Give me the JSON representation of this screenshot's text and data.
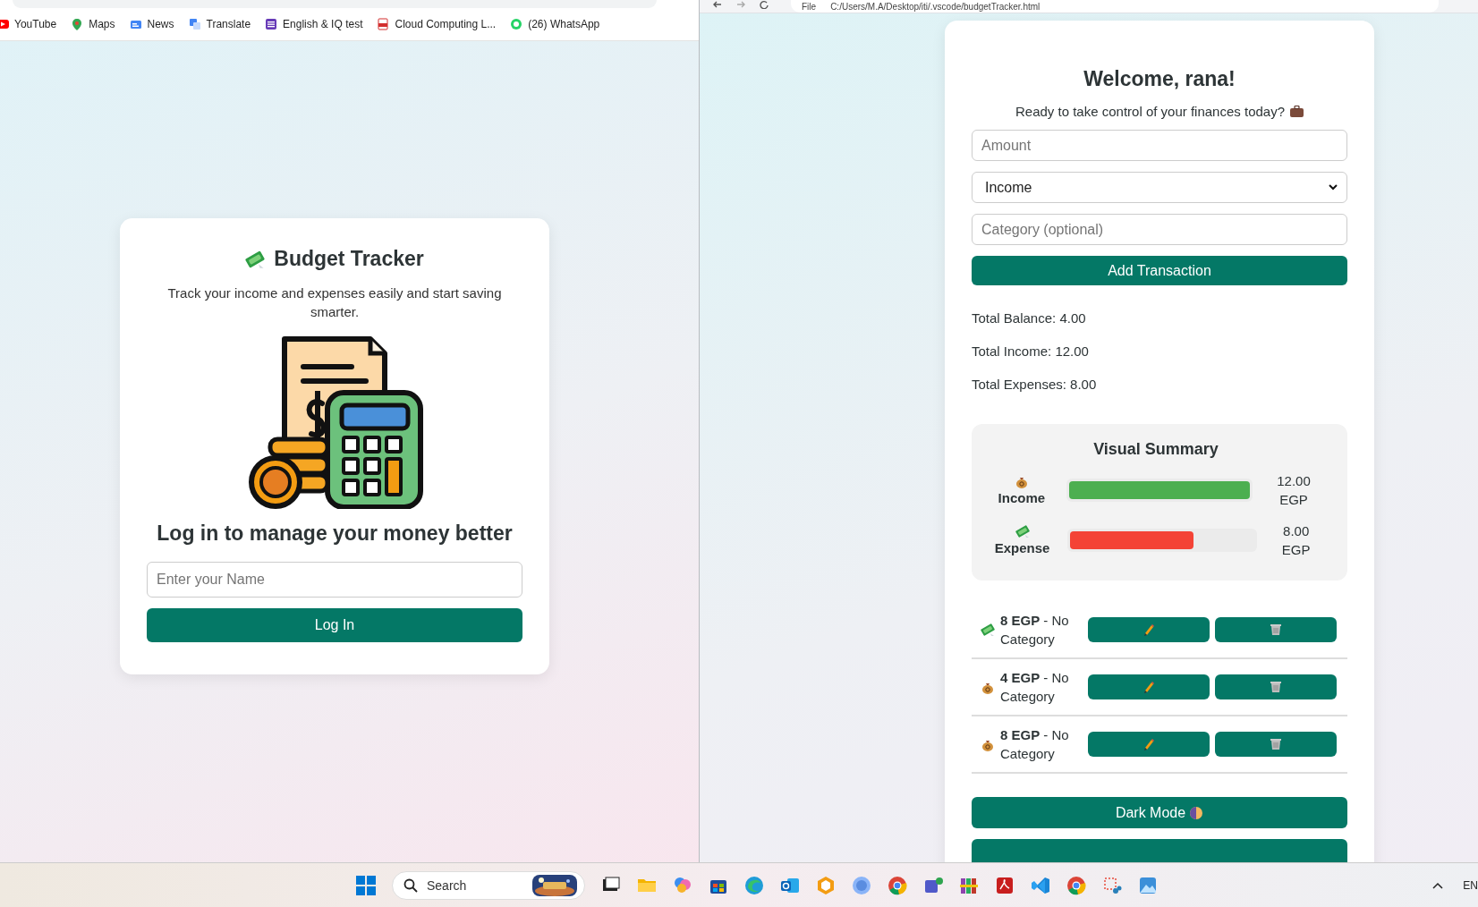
{
  "left_window": {
    "bookmarks": [
      {
        "kind": "youtube",
        "label": "YouTube"
      },
      {
        "kind": "maps",
        "label": "Maps"
      },
      {
        "kind": "news",
        "label": "News"
      },
      {
        "kind": "translate",
        "label": "Translate"
      },
      {
        "kind": "list",
        "label": "English & IQ test"
      },
      {
        "kind": "pdf",
        "label": "Cloud Computing L..."
      },
      {
        "kind": "chat",
        "label": "(26) WhatsApp"
      }
    ],
    "login_card": {
      "title": "Budget Tracker",
      "subtitle": "Track your income and expenses easily and start saving smarter.",
      "heading": "Log in to manage your money better",
      "name_field": {
        "placeholder": "Enter your Name"
      },
      "button": "Log In"
    }
  },
  "right_window": {
    "address": {
      "scheme": "File",
      "url": "C:/Users/M.A/Desktop/iti/.vscode/budgetTracker.html"
    },
    "welcome": "Welcome, rana!",
    "prompt": "Ready to take control of your finances today?",
    "amount_field": {
      "placeholder": "Amount"
    },
    "type_select": {
      "value": "Income"
    },
    "category_field": {
      "placeholder": "Category (optional)"
    },
    "add_button": "Add Transaction",
    "totals": [
      "Total Balance: 4.00",
      "Total Income: 12.00",
      "Total Expenses: 8.00"
    ],
    "summary": {
      "title": "Visual Summary",
      "bars": [
        {
          "kind": "income",
          "label": "Income",
          "level": 1,
          "reading": "12.00 EGP"
        },
        {
          "kind": "expense",
          "label": "Expense",
          "level": 0.667,
          "reading": "8.00 EGP"
        }
      ]
    },
    "transactions": [
      {
        "kind": "expense",
        "amount": "8 EGP",
        "category": " - No Category"
      },
      {
        "kind": "income",
        "amount": "4 EGP",
        "category": " - No Category"
      },
      {
        "kind": "income",
        "amount": "8 EGP",
        "category": " - No Category"
      }
    ],
    "dark_mode_button": "Dark Mode"
  },
  "taskbar": {
    "search": {
      "placeholder": "Search"
    },
    "language": "EN"
  }
}
